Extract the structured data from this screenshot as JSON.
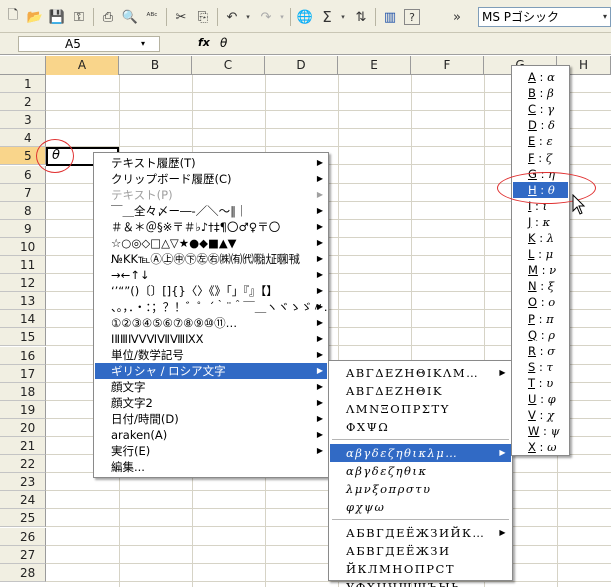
{
  "toolbar": {
    "buttons": [
      "new-file-icon",
      "open-folder-icon",
      "save-icon",
      "permission-icon",
      "print-icon",
      "print-preview-icon",
      "spellcheck-icon",
      "cut-icon",
      "copy-icon",
      "undo-icon",
      "redo-icon",
      "hyperlink-icon",
      "autosum-icon",
      "sort-icon",
      "chart-wizard-icon",
      "help-icon",
      "overflow-icon"
    ],
    "glyphs": {
      "new": "🗋",
      "open": "📂",
      "save": "💾",
      "perm": "⚿",
      "print": "⎙",
      "preview": "🔍",
      "spell": "ᴬᴮᶜ",
      "cut": "✂",
      "copy": "⎘",
      "undo": "↶",
      "redo": "↷",
      "link": "🌐",
      "sum": "Σ",
      "sort": "⇅",
      "chart": "▥",
      "help": "?",
      "more": "»",
      "dd": "▾"
    },
    "font_name": "MS Pゴシック"
  },
  "formula_bar": {
    "name_box": "A5",
    "fx": "fx",
    "value": "θ"
  },
  "columns": [
    "A",
    "B",
    "C",
    "D",
    "E",
    "F",
    "G",
    "H"
  ],
  "rows": [
    "1",
    "2",
    "3",
    "4",
    "5",
    "6",
    "7",
    "8",
    "9",
    "10",
    "11",
    "12",
    "13",
    "14",
    "15",
    "16",
    "17",
    "18",
    "19",
    "20",
    "21",
    "22",
    "23",
    "24",
    "25",
    "26",
    "27",
    "28"
  ],
  "cell_a5": "θ",
  "main_menu": [
    {
      "label": "テキスト履歴(T)",
      "disabled": false,
      "submenu": true
    },
    {
      "label": "クリップボード履歴(C)",
      "disabled": false,
      "submenu": true
    },
    {
      "label": "テキスト(P)",
      "disabled": true,
      "submenu": true
    },
    {
      "label": "￣＿全々〆ー―‐／＼～∥｜",
      "disabled": false,
      "submenu": true
    },
    {
      "label": "＃＆＊＠§※〒＃♭♪†‡¶〇♂♀〒〇",
      "disabled": false,
      "submenu": true
    },
    {
      "label": "☆○◎◇□△▽★●◆■▲▼",
      "disabled": false,
      "submenu": true
    },
    {
      "label": "№KK℡Ⓐ㊤㊥㊦㊧㊨㈱㈲㈹㍾㍽㍼㍻",
      "disabled": false,
      "submenu": true
    },
    {
      "label": "→←↑↓",
      "disabled": false,
      "submenu": true
    },
    {
      "label": "‘’“”()〔〕[]{}〈〉《》「」『』【】",
      "disabled": false,
      "submenu": true
    },
    {
      "label": "、。，．・：；？！゛゜´｀¨＾￣＿ヽヾゝゞ〃…‥",
      "disabled": false,
      "submenu": true
    },
    {
      "label": "①②③④⑤⑥⑦⑧⑨⑩⑪…",
      "disabled": false,
      "submenu": true
    },
    {
      "label": "ⅠⅡⅢⅣⅤⅥⅦⅧⅨⅩ",
      "disabled": false,
      "submenu": true
    },
    {
      "label": "単位/数学記号",
      "disabled": false,
      "submenu": true
    },
    {
      "label": "ギリシャ / ロシア文字",
      "disabled": false,
      "submenu": true,
      "highlighted": true
    },
    {
      "label": "顔文字",
      "disabled": false,
      "submenu": true
    },
    {
      "label": "顔文字2",
      "disabled": false,
      "submenu": true
    },
    {
      "label": "日付/時間(D)",
      "disabled": false,
      "submenu": true
    },
    {
      "label": "araken(A)",
      "disabled": false,
      "submenu": true
    },
    {
      "label": "実行(E)",
      "disabled": false,
      "submenu": true
    },
    {
      "label": "編集...",
      "disabled": false,
      "submenu": false
    }
  ],
  "greek_menu": [
    {
      "label": "ΑΒΓΔΕΖΗΘΙΚΛΜ…",
      "submenu": true
    },
    {
      "label": "ΑΒΓΔΕΖΗΘΙΚ",
      "submenu": false
    },
    {
      "label": "ΛΜΝΞΟΠΡΣΤΥ",
      "submenu": false
    },
    {
      "label": "ΦΧΨΩ",
      "submenu": false
    },
    {
      "label": "αβγδεζηθικλμ…",
      "submenu": true,
      "highlighted": true
    },
    {
      "label": "αβγδεζηθικ",
      "submenu": false
    },
    {
      "label": "λμνξοπρστυ",
      "submenu": false
    },
    {
      "label": "φχψω",
      "submenu": false
    },
    {
      "label": "АБВГДЕЁЖЗИЙК…",
      "submenu": true
    },
    {
      "label": "АБВГДЕЁЖЗИ",
      "submenu": false
    },
    {
      "label": "ЙКЛМНОПРСТ",
      "submenu": false
    },
    {
      "label": "УФХЦЧШЩЪЫЬ",
      "submenu": false
    }
  ],
  "letter_menu": [
    {
      "key": "A",
      "char": "α"
    },
    {
      "key": "B",
      "char": "β"
    },
    {
      "key": "C",
      "char": "γ"
    },
    {
      "key": "D",
      "char": "δ"
    },
    {
      "key": "E",
      "char": "ε"
    },
    {
      "key": "F",
      "char": "ζ"
    },
    {
      "key": "G",
      "char": "η"
    },
    {
      "key": "H",
      "char": "θ",
      "highlighted": true
    },
    {
      "key": "I",
      "char": "ι"
    },
    {
      "key": "J",
      "char": "κ"
    },
    {
      "key": "K",
      "char": "λ"
    },
    {
      "key": "L",
      "char": "μ"
    },
    {
      "key": "M",
      "char": "ν"
    },
    {
      "key": "N",
      "char": "ξ"
    },
    {
      "key": "O",
      "char": "ο"
    },
    {
      "key": "P",
      "char": "π"
    },
    {
      "key": "Q",
      "char": "ρ"
    },
    {
      "key": "R",
      "char": "σ"
    },
    {
      "key": "S",
      "char": "τ"
    },
    {
      "key": "T",
      "char": "υ"
    },
    {
      "key": "U",
      "char": "φ"
    },
    {
      "key": "V",
      "char": "χ"
    },
    {
      "key": "W",
      "char": "ψ"
    },
    {
      "key": "X",
      "char": "ω"
    }
  ],
  "colors": {
    "highlight": "#316ac5",
    "annotation": "#e03030",
    "selected_header": "#f9d58b"
  }
}
